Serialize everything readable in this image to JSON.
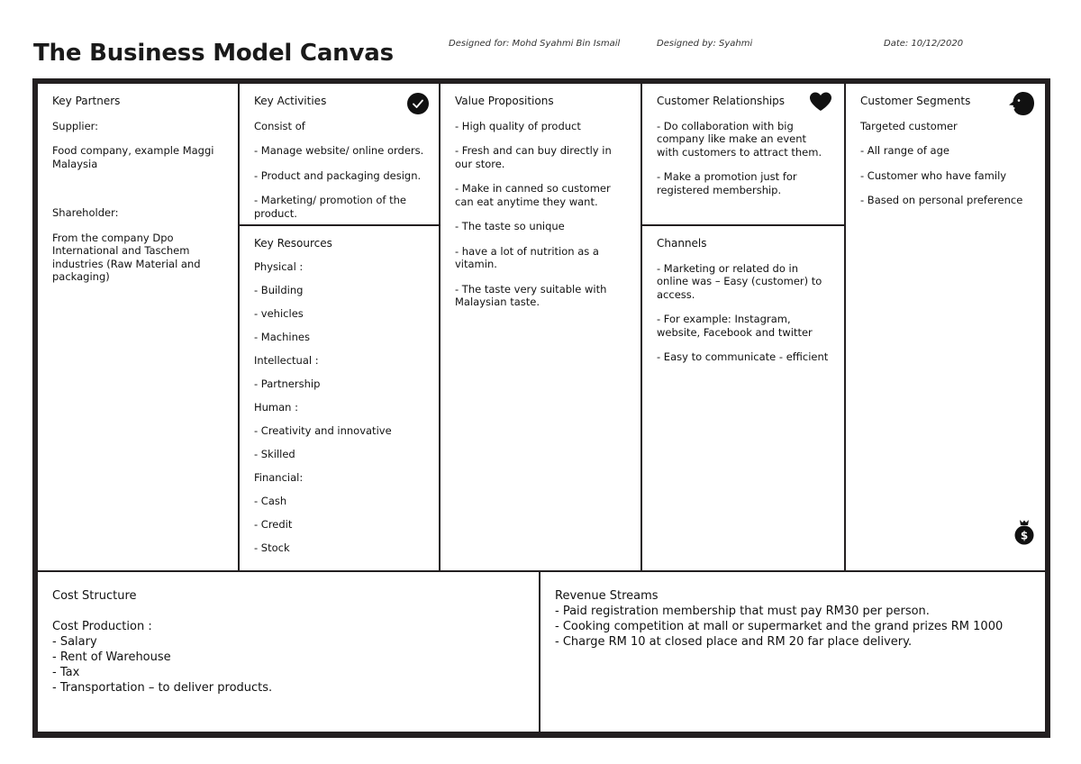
{
  "header": {
    "title": "The Business Model Canvas",
    "designed_for": "Designed for: Mohd Syahmi Bin Ismail",
    "designed_by": "Designed by: Syahmi",
    "date": "Date: 10/12/2020"
  },
  "canvas": {
    "key_partners": {
      "title": "Key Partners",
      "items": [
        "Supplier:",
        "Food company, example Maggi Malaysia",
        "",
        "Shareholder:",
        "From the company Dpo International and Taschem industries (Raw Material and packaging)"
      ]
    },
    "key_activities": {
      "title": "Key Activities",
      "icon": "checkmark-icon",
      "items": [
        "Consist of",
        "- Manage website/ online orders.",
        "- Product and packaging design.",
        "- Marketing/ promotion of the product."
      ]
    },
    "key_resources": {
      "title": "Key Resources",
      "items": [
        "Physical :",
        "- Building",
        "- vehicles",
        "- Machines",
        "Intellectual :",
        "- Partnership",
        "Human :",
        "- Creativity and innovative",
        "- Skilled",
        "Financial:",
        "- Cash",
        "- Credit",
        "- Stock"
      ]
    },
    "value_propositions": {
      "title": "Value Propositions",
      "items": [
        "- High quality of product",
        "- Fresh and can buy directly in our store.",
        "- Make in canned so customer can eat anytime they want.",
        "- The taste so unique",
        "- have a lot of nutrition as a vitamin.",
        "- The taste very suitable with Malaysian taste."
      ]
    },
    "customer_relationships": {
      "title": "Customer Relationships",
      "icon": "heart-icon",
      "items": [
        "- Do collaboration with big company like make an event with customers to attract them.",
        "- Make a promotion just for registered membership."
      ]
    },
    "channels": {
      "title": "Channels",
      "items": [
        "- Marketing or related do in online was – Easy (customer) to access.",
        "- For example: Instagram, website, Facebook and twitter",
        "- Easy to communicate - efficient"
      ]
    },
    "customer_segments": {
      "title": "Customer Segments",
      "icon": "person-head-icon",
      "items": [
        "Targeted customer",
        "- All range of age",
        "- Customer who have family",
        "- Based on personal preference"
      ],
      "corner_icon": "money-bag-icon"
    },
    "cost_structure": {
      "title": "Cost Structure",
      "subtitle": "Cost Production :",
      "items": [
        "- Salary",
        "- Rent of Warehouse",
        "- Tax",
        "- Transportation – to deliver products."
      ]
    },
    "revenue_streams": {
      "title": "Revenue Streams",
      "items": [
        "- Paid registration membership that must pay RM30 per person.",
        "- Cooking competition at mall or supermarket and the grand prizes RM 1000",
        "- Charge RM 10 at closed place and RM 20 far place delivery."
      ]
    }
  }
}
